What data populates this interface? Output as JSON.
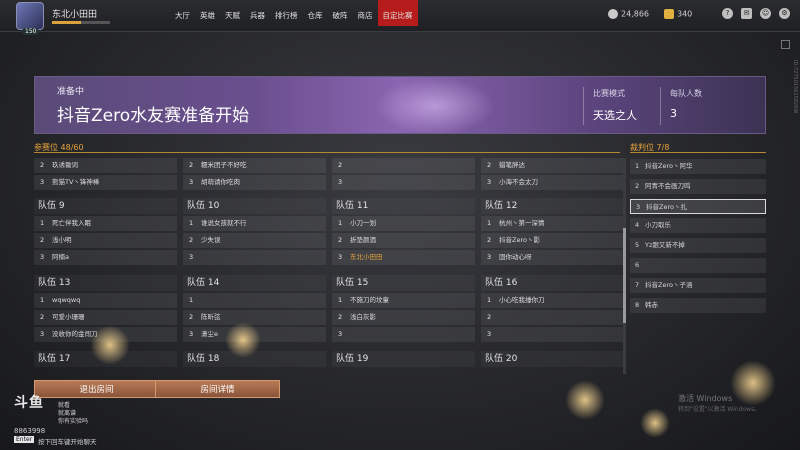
{
  "player": {
    "name": "东北小田田",
    "level": "150"
  },
  "nav": {
    "items": [
      "大厅",
      "英雄",
      "天赋",
      "兵器",
      "排行榜",
      "仓库",
      "破阵",
      "商店",
      "自定比赛"
    ]
  },
  "currency": {
    "coins": "24,866",
    "gold": "340"
  },
  "banner": {
    "status": "准备中",
    "title": "抖音Zero水友赛准备开始",
    "mode_label": "比赛模式",
    "mode_value": "天选之人",
    "team_size_label": "每队人数",
    "team_size_value": "3"
  },
  "participants": {
    "header": "参赛位 48/60"
  },
  "top_rows": [
    [
      {
        "n": "2",
        "name": "玖诱锄词"
      },
      {
        "n": "3",
        "name": "熊猫TV丶锋神棒"
      }
    ],
    [
      {
        "n": "2",
        "name": "糯米团子不好吃"
      },
      {
        "n": "3",
        "name": "胡萌请你吃肉"
      }
    ],
    [
      {
        "n": "2",
        "name": ""
      },
      {
        "n": "3",
        "name": ""
      }
    ],
    [
      {
        "n": "2",
        "name": "蜡笔胖达"
      },
      {
        "n": "3",
        "name": "小海不会太刀"
      }
    ]
  ],
  "teams": [
    {
      "title": "队伍 9",
      "members": [
        {
          "n": "1",
          "name": "死亡伴我入眠"
        },
        {
          "n": "2",
          "name": "浅小明"
        },
        {
          "n": "3",
          "name": "阿楠a"
        }
      ]
    },
    {
      "title": "队伍 10",
      "members": [
        {
          "n": "1",
          "name": "谁说女孩就不行"
        },
        {
          "n": "2",
          "name": "少失误"
        },
        {
          "n": "3",
          "name": ""
        }
      ]
    },
    {
      "title": "队伍 11",
      "members": [
        {
          "n": "1",
          "name": "小刀一划"
        },
        {
          "n": "2",
          "name": "折垫颜酒"
        },
        {
          "n": "3",
          "name": "东北小田田",
          "highlight": true
        }
      ]
    },
    {
      "title": "队伍 12",
      "members": [
        {
          "n": "1",
          "name": "杭州丶第一深情"
        },
        {
          "n": "2",
          "name": "抖音Zero丶影"
        },
        {
          "n": "3",
          "name": "固你动心呀"
        }
      ]
    },
    {
      "title": "队伍 13",
      "members": [
        {
          "n": "1",
          "name": "wqwqwq"
        },
        {
          "n": "2",
          "name": "可爱小珊珊"
        },
        {
          "n": "3",
          "name": "没收你的金闯刀"
        }
      ]
    },
    {
      "title": "队伍 14",
      "members": [
        {
          "n": "1",
          "name": ""
        },
        {
          "n": "2",
          "name": "陈昕弦"
        },
        {
          "n": "3",
          "name": "潇尘e"
        }
      ]
    },
    {
      "title": "队伍 15",
      "members": [
        {
          "n": "1",
          "name": "不施刀的坟童"
        },
        {
          "n": "2",
          "name": "浅白灰影"
        },
        {
          "n": "3",
          "name": ""
        }
      ]
    },
    {
      "title": "队伍 16",
      "members": [
        {
          "n": "1",
          "name": "小心吃我捶你刀"
        },
        {
          "n": "2",
          "name": ""
        },
        {
          "n": "3",
          "name": ""
        }
      ]
    },
    {
      "title": "队伍 17",
      "members": []
    },
    {
      "title": "队伍 18",
      "members": []
    },
    {
      "title": "队伍 19",
      "members": []
    },
    {
      "title": "队伍 20",
      "members": []
    }
  ],
  "referees": {
    "header": "裁判位 7/8",
    "items": [
      {
        "n": "1",
        "name": "抖音Zero丶阿华"
      },
      {
        "n": "2",
        "name": "阿青不会画刀鸣"
      },
      {
        "n": "3",
        "name": "抖音Zero丶扎",
        "selected": true
      },
      {
        "n": "4",
        "name": "小刀取乐"
      },
      {
        "n": "5",
        "name": "Yz跟又新不掉"
      },
      {
        "n": "6",
        "name": ""
      },
      {
        "n": "7",
        "name": "抖音Zero丶子涵"
      },
      {
        "n": "8",
        "name": "韩赤"
      }
    ]
  },
  "buttons": {
    "leave": "退出房间",
    "details": "房间详情"
  },
  "overlay": {
    "logo": "斗鱼",
    "room_no": "8863998",
    "chat_lines": [
      "就看",
      "就离谱",
      "你有实验吗"
    ],
    "enter_key": "Enter",
    "enter_hint": "按下回车键开始聊天",
    "side_id": "ID:7275015615826W",
    "windows_line1": "激活 Windows",
    "windows_line2": "转到\"设置\"以激活 Windows。"
  }
}
